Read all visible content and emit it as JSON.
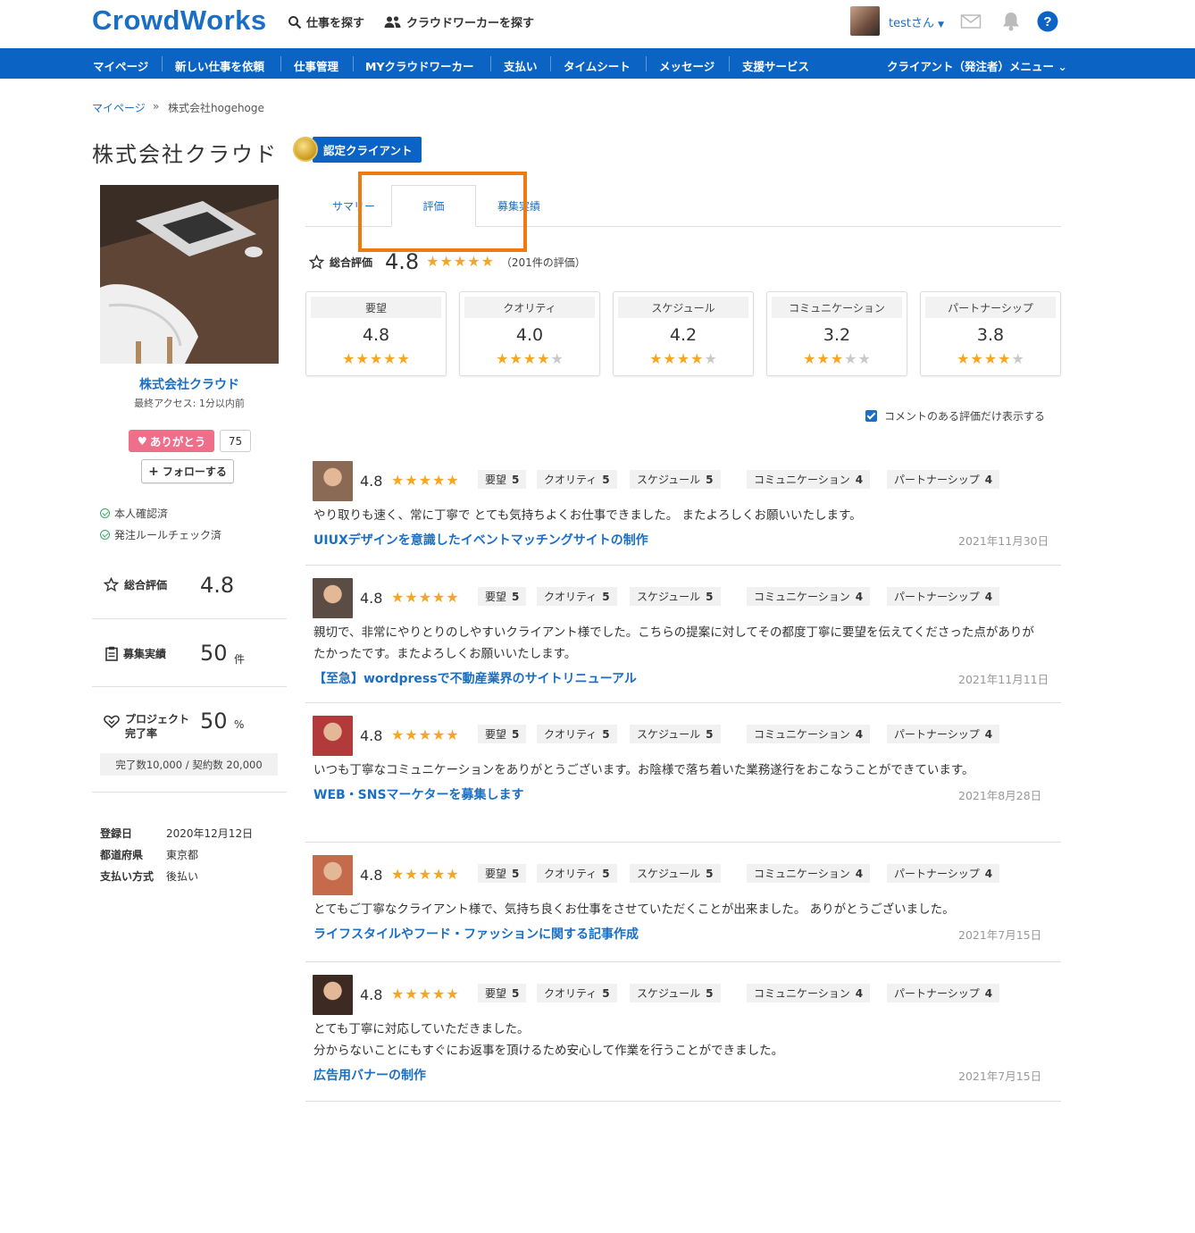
{
  "header": {
    "logo": "CrowdWorks",
    "search_jobs": "仕事を探す",
    "search_workers": "クラウドワーカーを探す",
    "user": "testさん"
  },
  "nav": {
    "items": [
      "マイページ",
      "新しい仕事を依頼",
      "仕事管理",
      "MYクラウドワーカー",
      "支払い",
      "タイムシート",
      "メッセージ",
      "支援サービス"
    ],
    "client_menu": "クライアント（発注者）メニュー"
  },
  "breadcrumb": {
    "home": "マイページ",
    "sep": "»",
    "current": "株式会社hogehoge"
  },
  "company": {
    "title": "株式会社クラウド",
    "badge": "認定クライアント"
  },
  "profile": {
    "name": "株式会社クラウド",
    "last_access": "最終アクセス: 1分以内前",
    "thanks": "ありがとう",
    "thanks_count": "75",
    "follow": "フォローする",
    "checks": [
      "本人確認済",
      "発注ルールチェック済"
    ],
    "rating_label": "総合評価",
    "rating_value": "4.8",
    "jobs_label": "募集実績",
    "jobs_value": "50",
    "jobs_unit": "件",
    "completion_label_1": "プロジェクト",
    "completion_label_2": "完了率",
    "completion_value": "50",
    "completion_unit": "%",
    "completion_note": "完了数10,000 / 契約数 20,000",
    "info": [
      {
        "key": "登録日",
        "value": "2020年12月12日"
      },
      {
        "key": "都道府県",
        "value": "東京都"
      },
      {
        "key": "支払い方式",
        "value": "後払い"
      }
    ]
  },
  "tabs": [
    "サマリー",
    "評価",
    "募集実績"
  ],
  "summary": {
    "label": "総合評価",
    "score": "4.8",
    "score_value": 4.8,
    "count": "（201件の評価）",
    "categories": [
      {
        "name": "要望",
        "value": "4.8",
        "stars": 5
      },
      {
        "name": "クオリティ",
        "value": "4.0",
        "stars": 4
      },
      {
        "name": "スケジュール",
        "value": "4.2",
        "stars": 4
      },
      {
        "name": "コミュニケーション",
        "value": "3.2",
        "stars": 3
      },
      {
        "name": "パートナーシップ",
        "value": "3.8",
        "stars": 4
      }
    ]
  },
  "filter_label": "コメントのある評価だけ表示する",
  "review_chip_labels": [
    "要望",
    "クオリティ",
    "スケジュール",
    "コミュニケーション",
    "パートナーシップ"
  ],
  "reviews": [
    {
      "score": "4.8",
      "chips": [
        "5",
        "5",
        "5",
        "4",
        "4"
      ],
      "text": "やり取りも速く、常に丁寧で とても気持ちよくお仕事できました。 またよろしくお願いいたします。",
      "link": "UIUXデザインを意識したイベントマッチングサイトの制作",
      "date": "2021年11月30日",
      "avatar_color": "#8a6a55"
    },
    {
      "score": "4.8",
      "chips": [
        "5",
        "5",
        "5",
        "4",
        "4"
      ],
      "text": "親切で、非常にやりとりのしやすいクライアント様でした。こちらの提案に対してその都度丁寧に要望を伝えてくださった点がありがたかったです。またよろしくお願いいたします。",
      "link": "【至急】wordpressで不動産業界のサイトリニューアル",
      "date": "2021年11月11日",
      "avatar_color": "#5b4c44"
    },
    {
      "score": "4.8",
      "chips": [
        "5",
        "5",
        "5",
        "4",
        "4"
      ],
      "text": "いつも丁寧なコミュニケーションをありがとうございます。お陰様で落ち着いた業務遂行をおこなうことができています。",
      "link": "WEB・SNSマーケターを募集します",
      "date": "2021年8月28日",
      "avatar_color": "#b23a3a"
    },
    {
      "score": "4.8",
      "chips": [
        "5",
        "5",
        "5",
        "4",
        "4"
      ],
      "text": "とてもご丁寧なクライアント様で、気持ち良くお仕事をさせていただくことが出来ました。 ありがとうございました。",
      "link": "ライフスタイルやフード・ファッションに関する記事作成",
      "date": "2021年7月15日",
      "avatar_color": "#c56a4a"
    },
    {
      "score": "4.8",
      "chips": [
        "5",
        "5",
        "5",
        "4",
        "4"
      ],
      "text_lines": [
        "とても丁寧に対応していただきました。",
        "分からないことにもすぐにお返事を頂けるため安心して作業を行うことができました。"
      ],
      "link": "広告用バナーの制作",
      "date": "2021年7月15日",
      "avatar_color": "#3d2a22"
    }
  ],
  "colors": {
    "brand": "#0b63c4",
    "link": "#1a6fc4",
    "star": "#f5a623",
    "highlight": "#ee7a12",
    "thanks": "#ee6f8a"
  }
}
